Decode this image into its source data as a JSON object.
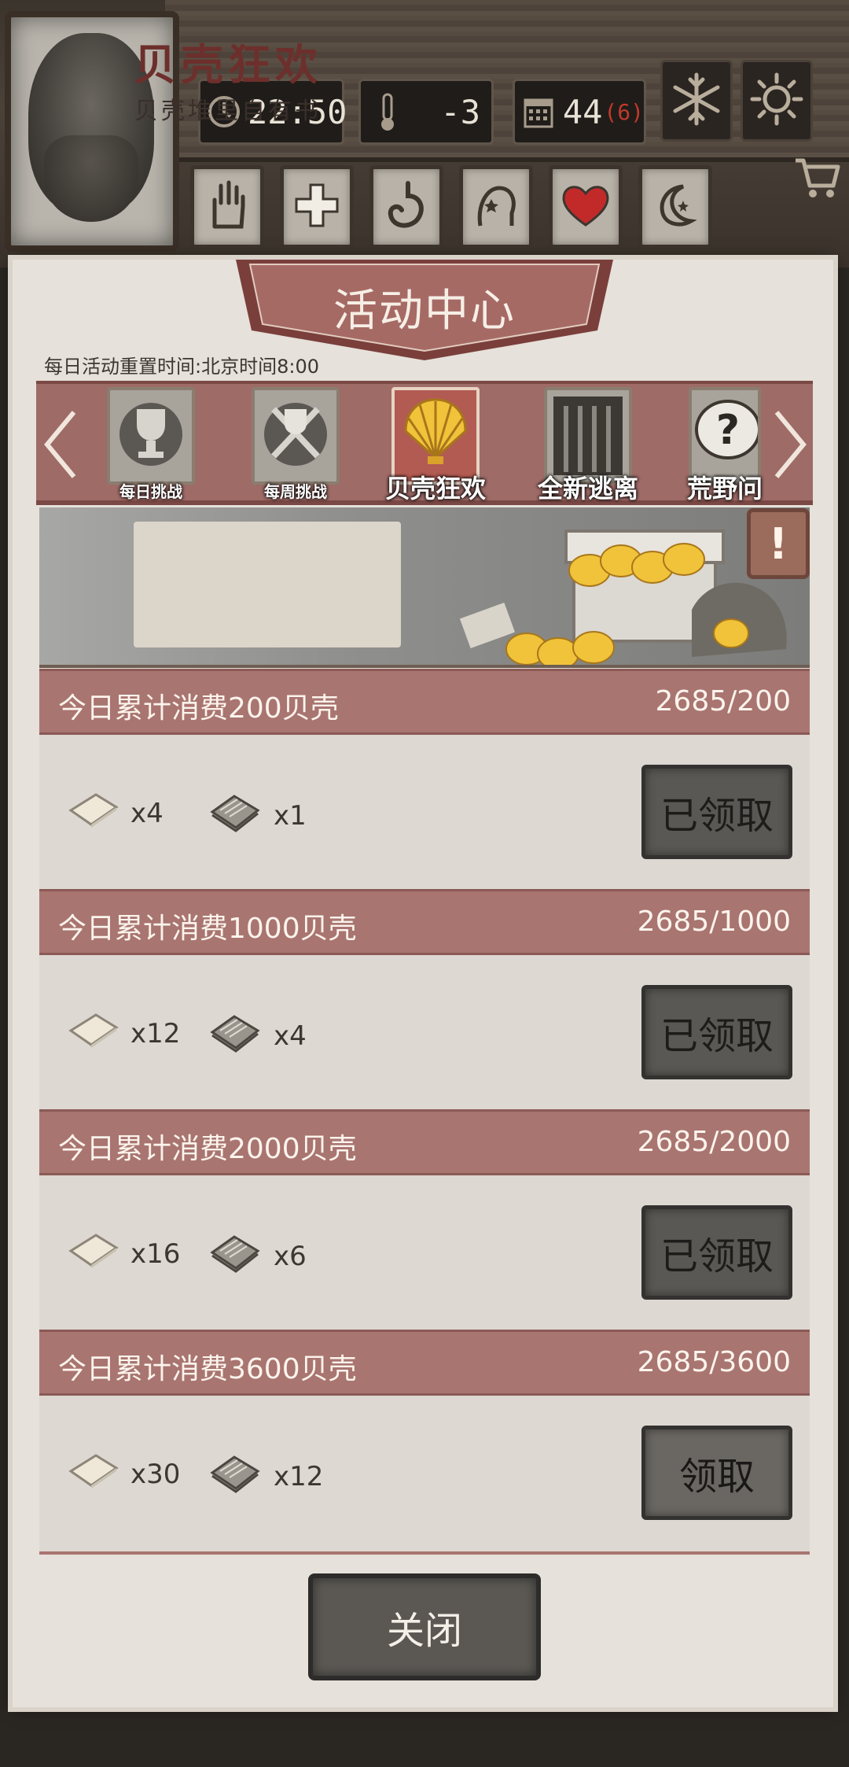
{
  "hud": {
    "time": "22:50",
    "temperature": "-3",
    "day": "44",
    "day_sub": "(6)",
    "weather_icons": [
      "snowflake-icon",
      "sun-icon"
    ],
    "status_icons": [
      "hand-icon",
      "health-cross-icon",
      "stomach-icon",
      "mind-icon",
      "heart-icon",
      "moon-icon"
    ]
  },
  "panel": {
    "title": "活动中心",
    "reset_note": "每日活动重置时间:北京时间8:00",
    "close_label": "关闭"
  },
  "tabs": [
    {
      "label": "每日挑战",
      "icon": "trophy-icon",
      "active": false
    },
    {
      "label": "每周挑战",
      "icon": "crossed-weapons-icon",
      "active": false
    },
    {
      "label": "贝壳狂欢",
      "icon": "shell-icon",
      "active": true
    },
    {
      "label": "全新逃离",
      "icon": "prison-bars-icon",
      "active": false
    },
    {
      "label": "荒野问",
      "icon": "question-bubble-icon",
      "active": false
    }
  ],
  "promo": {
    "title": "贝壳狂欢",
    "subtitle": "贝壳堆里自有书",
    "info": "!"
  },
  "rows": [
    {
      "title": "今日累计消费200贝壳",
      "progress": "2685/200",
      "paper": "x4",
      "book": "x1",
      "button": "已领取"
    },
    {
      "title": "今日累计消费1000贝壳",
      "progress": "2685/1000",
      "paper": "x12",
      "book": "x4",
      "button": "已领取"
    },
    {
      "title": "今日累计消费2000贝壳",
      "progress": "2685/2000",
      "paper": "x16",
      "book": "x6",
      "button": "已领取"
    },
    {
      "title": "今日累计消费3600贝壳",
      "progress": "2685/3600",
      "paper": "x30",
      "book": "x12",
      "button": "领取"
    }
  ],
  "colors": {
    "tab_bar": "#9e6b67",
    "row_header": "#a97571",
    "panel_bg": "#e6e1da",
    "alert_red": "#c0392b"
  }
}
